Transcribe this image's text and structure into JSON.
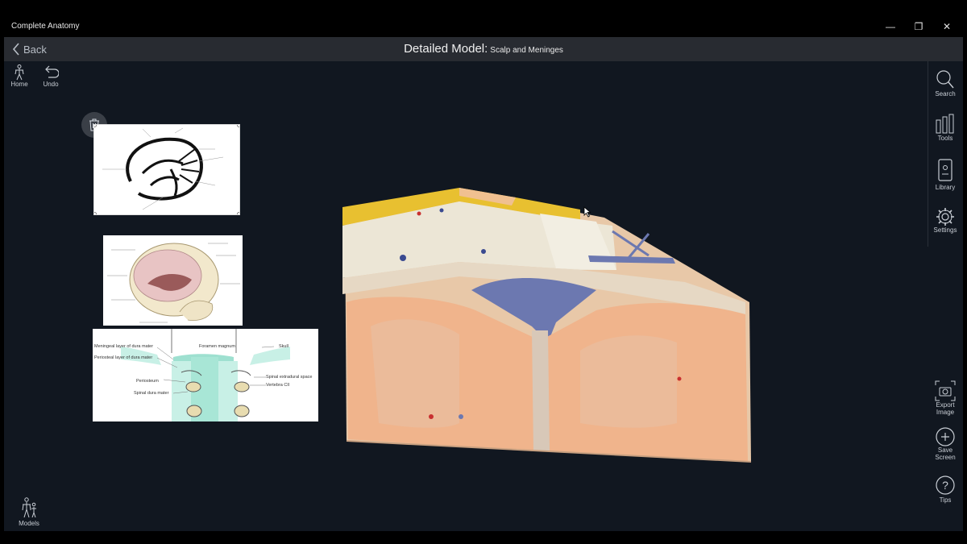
{
  "window": {
    "app_title": "Complete Anatomy",
    "controls": {
      "minimize": "—",
      "restore": "❐",
      "close": "✕"
    }
  },
  "header": {
    "back_label": "Back",
    "title_main": "Detailed Model:",
    "title_sub": "Scalp and Meninges"
  },
  "left_toolbar": {
    "home": "Home",
    "undo": "Undo",
    "models": "Models"
  },
  "right_toolbar": {
    "search": "Search",
    "tools": "Tools",
    "library": "Library",
    "settings": "Settings",
    "export_image_line1": "Export",
    "export_image_line2": "Image",
    "save_screen_line1": "Save",
    "save_screen_line2": "Screen",
    "tips": "Tips"
  },
  "reference_images": {
    "spinal_labels": {
      "meningeal": "Meningeal layer of dura mater",
      "periosteal": "Periosteal layer of dura mater",
      "foramen": "Foramen magnum",
      "skull": "Skull",
      "periosteum": "Periosteum",
      "spinal_dura": "Spinal dura mater",
      "extradural": "Spinal extradural space",
      "vertebra": "Vertebra CII"
    }
  },
  "colors": {
    "stage_bg": "#111720",
    "header_bg": "#282b31",
    "titlebar_bg": "#000000",
    "brain_tissue": "#f0b48c",
    "scalp_fat": "#e8c030",
    "bone": "#ece6d6",
    "sinus_blue": "#6c78b0"
  }
}
